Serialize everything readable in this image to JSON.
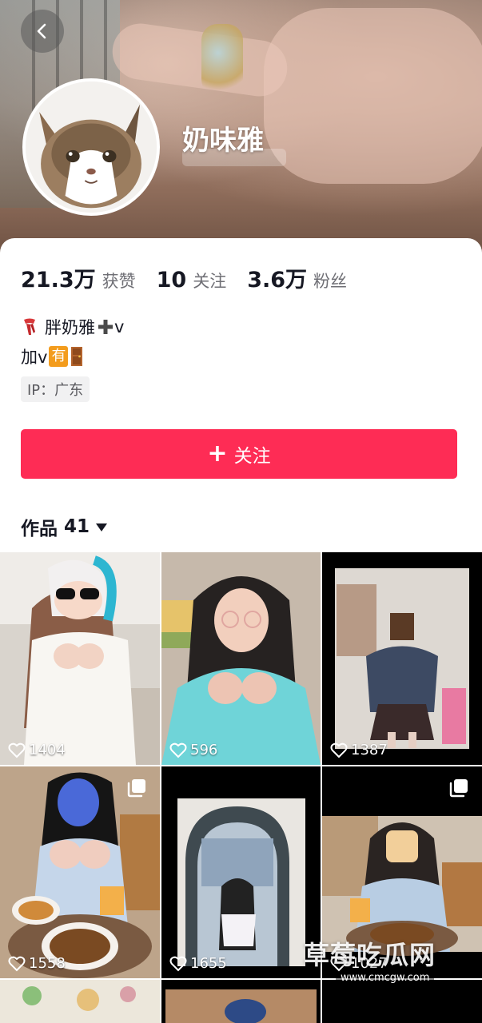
{
  "profile": {
    "username": "奶味雅",
    "stats": {
      "likes_value": "21.3万",
      "likes_label": "获赞",
      "following_value": "10",
      "following_label": "关注",
      "followers_value": "3.6万",
      "followers_label": "粉丝"
    },
    "bio_line1": "胖奶雅",
    "bio_line1_suffix": "v",
    "bio_line2_prefix": "加v",
    "bio_line2_badge": "有",
    "ip_label": "IP：广东",
    "follow_button": "关注"
  },
  "works": {
    "label": "作品",
    "count": "41"
  },
  "grid": [
    {
      "likes": "1404",
      "multi": false
    },
    {
      "likes": "596",
      "multi": false
    },
    {
      "likes": "1387",
      "multi": false
    },
    {
      "likes": "1558",
      "multi": true
    },
    {
      "likes": "1655",
      "multi": false
    },
    {
      "likes": "1027",
      "multi": true
    }
  ],
  "watermark": {
    "text": "草莓吃瓜网",
    "sub": "www.cmcgw.com"
  },
  "icons": {
    "back": "chevron-left-icon",
    "heart": "heart-outline-icon",
    "multi": "multi-image-icon",
    "caret": "caret-down-icon"
  },
  "colors": {
    "accent": "#fe2c55",
    "badge": "#f39c1d"
  }
}
